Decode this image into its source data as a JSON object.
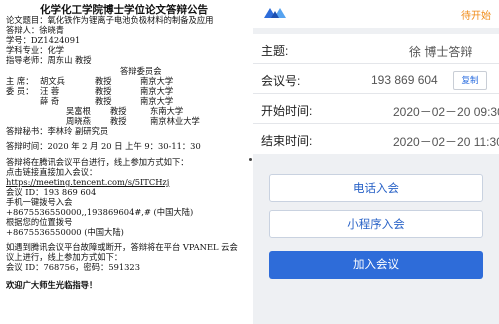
{
  "document": {
    "title": "化学化工学院博士学位论文答辩公告",
    "thesis_title": "论文题目：氧化铁作为锂离子电池负极材料的制备及应用",
    "author": "答辩人：徐晓青",
    "student_id": "学号：DZ1424091",
    "major": "学科专业：化学",
    "advisor": "指导老师：周东山 教授",
    "committee_heading": "答辩委员会",
    "committee": [
      {
        "role": "主 席：",
        "name": "胡文兵",
        "title": "教授",
        "org": "南京大学"
      },
      {
        "role": "委 员：",
        "name": "汪 蓉",
        "title": "教授",
        "org": "南京大学"
      },
      {
        "role": "",
        "name": "薛 奇",
        "title": "教授",
        "org": "南京大学"
      },
      {
        "role": "",
        "name": "吴富根",
        "title": "教授",
        "org": "东南大学"
      },
      {
        "role": "",
        "name": "周晓燕",
        "title": "教授",
        "org": "南京林业大学"
      }
    ],
    "secretary": "答辩秘书：李林玲    副研究员",
    "time": "答辩时间：2020 年 2 月 20 日 上午 9：30-11：30",
    "online_note": "答辩将在腾讯会议平台进行，线上参加方式如下：",
    "link_join": "点击链接直接加入会议：",
    "url": "https://meeting.tencent.com/s/5ITCHzj",
    "meeting_id": "会议 ID：193 869 604",
    "phone_join": "手机一键拨号入会",
    "phone_numbers": "+8675536550000,,193869604#,# (中国大陆)",
    "location_dial": "根据您的位置拨号",
    "location_number": "+8675536550000 (中国大陆)",
    "reconnect_note": "如遇到腾讯会议平台故障或断开，答辩将在平台 VPANEL 云会议上进行，线上参加方式如下：",
    "vpanel_id": "会议 ID：768756，密码：591323",
    "welcome": "欢迎广大师生光临指导！"
  },
  "app": {
    "status": "待开始",
    "topic_label": "主题:",
    "topic_value": "徐      博士答辩",
    "meeting_no_label": "会议号:",
    "meeting_no": "193 869 604",
    "copy_label": "复制",
    "start_label": "开始时间:",
    "start_value": "2020－02－20 09:30",
    "end_label": "结束时间:",
    "end_value": "2020－02－20 11:30",
    "btn_phone": "电话入会",
    "btn_miniprogram": "小程序入会",
    "btn_join": "加入会议",
    "brand_color": "#2e6cd9",
    "status_color": "#f08c1a"
  }
}
